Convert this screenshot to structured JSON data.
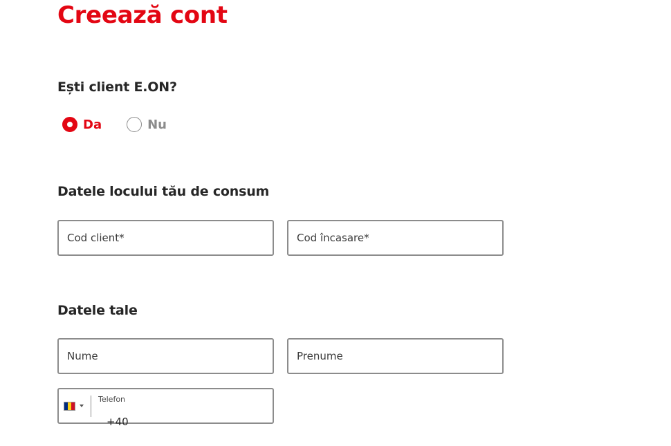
{
  "page": {
    "title": "Creează cont"
  },
  "client_question": {
    "heading": "Ești client E.ON?",
    "options": [
      {
        "label": "Da",
        "selected": true
      },
      {
        "label": "Nu",
        "selected": false
      }
    ]
  },
  "consumption_place": {
    "heading": "Datele locului tău de consum",
    "client_code_placeholder": "Cod client*",
    "collection_code_placeholder": "Cod încasare*"
  },
  "personal_data": {
    "heading": "Datele tale",
    "last_name_placeholder": "Nume",
    "first_name_placeholder": "Prenume",
    "phone": {
      "label": "Telefon",
      "value": "+40",
      "country_flag_icon": "romania-flag-icon",
      "flag_colors": [
        "#002b7f",
        "#fcd116",
        "#ce1126"
      ]
    }
  },
  "colors": {
    "accent": "#e30613",
    "text": "#262626",
    "border": "#8c8c8c"
  }
}
